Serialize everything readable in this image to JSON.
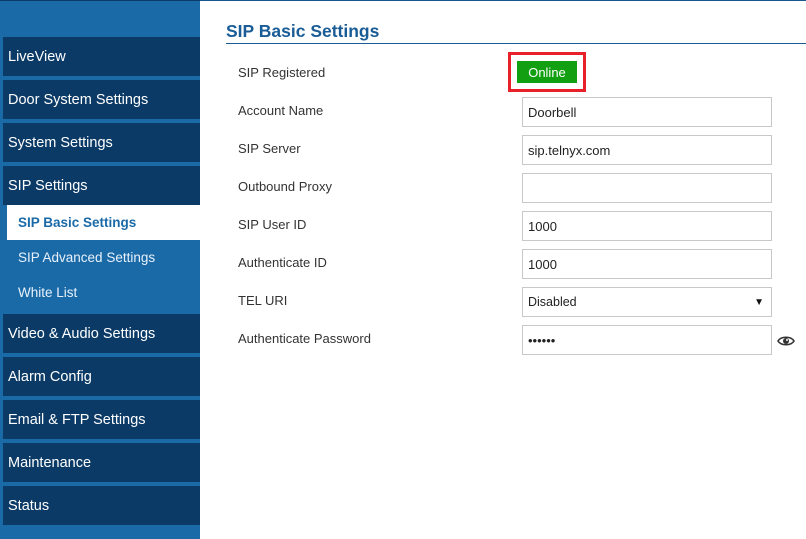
{
  "sidebar": {
    "items": [
      {
        "label": "LiveView"
      },
      {
        "label": "Door System Settings"
      },
      {
        "label": "System Settings"
      },
      {
        "label": "SIP Settings"
      },
      {
        "label": "Video & Audio Settings"
      },
      {
        "label": "Alarm Config"
      },
      {
        "label": "Email & FTP Settings"
      },
      {
        "label": "Maintenance"
      },
      {
        "label": "Status"
      }
    ],
    "subitems": [
      {
        "label": "SIP Basic Settings",
        "active": true
      },
      {
        "label": "SIP Advanced Settings",
        "active": false
      },
      {
        "label": "White List",
        "active": false
      }
    ]
  },
  "main": {
    "title": "SIP Basic Settings",
    "sip_registered": {
      "label": "SIP Registered",
      "status": "Online",
      "status_color": "#12a012"
    },
    "account_name": {
      "label": "Account Name",
      "value": "Doorbell"
    },
    "sip_server": {
      "label": "SIP Server",
      "value": "sip.telnyx.com"
    },
    "outbound_proxy": {
      "label": "Outbound Proxy",
      "value": ""
    },
    "sip_user_id": {
      "label": "SIP User ID",
      "value": "1000"
    },
    "authenticate_id": {
      "label": "Authenticate ID",
      "value": "1000"
    },
    "tel_uri": {
      "label": "TEL URI",
      "selected": "Disabled"
    },
    "authenticate_password": {
      "label": "Authenticate Password",
      "value": "••••••"
    }
  },
  "colors": {
    "nav_bg": "#0b3a66",
    "sidebar_bg": "#1a6aa8",
    "title": "#1a5c96",
    "highlight": "#e8202a"
  },
  "icons": {
    "password_toggle": "eye-icon",
    "select_arrow": "caret-down-icon"
  }
}
